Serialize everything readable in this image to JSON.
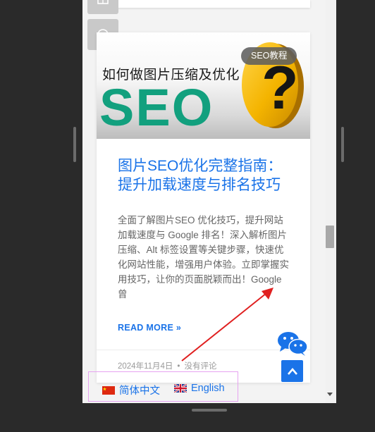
{
  "article": {
    "category": "SEO教程",
    "image_heading": "如何做图片压缩及优化",
    "image_big_text": "SEO",
    "title": "图片SEO优化完整指南：提升加载速度与排名技巧",
    "excerpt": "全面了解图片SEO 优化技巧，提升网站加载速度与 Google 排名！深入解析图片压缩、Alt 标签设置等关键步骤，快速优化网站性能，增强用户体验。立即掌握实用技巧，让你的页面脱颖而出！Google曾",
    "read_more": "READ MORE »",
    "date": "2024年11月4日",
    "separator": "•",
    "comments": "没有评论"
  },
  "share": {
    "icons": [
      "table-icon",
      "whatsapp-icon"
    ]
  },
  "floating": {
    "wechat_icon": "wechat-icon",
    "back_to_top_icon": "chevron-up-icon"
  },
  "language_switcher": {
    "chinese": "简体中文",
    "english": "English"
  },
  "colors": {
    "link": "#1a73e8",
    "badge_bg": "#5f5f5f",
    "annotation": "#e02020",
    "highlight_box": "#e6a3f0",
    "seo_green": "#12a07e"
  }
}
